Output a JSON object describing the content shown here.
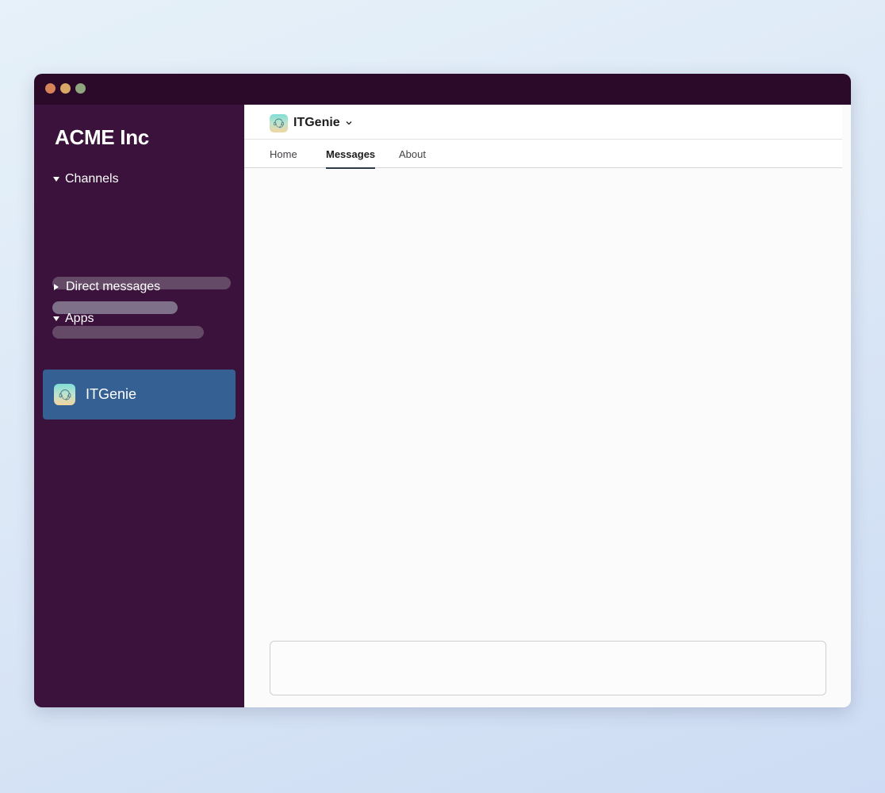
{
  "workspace": {
    "name": "ACME Inc"
  },
  "sidebar": {
    "sections": [
      {
        "label": "Channels",
        "expanded": true
      },
      {
        "label": "Direct messages",
        "expanded": false
      },
      {
        "label": "Apps",
        "expanded": true
      }
    ],
    "channel_placeholders": [
      {
        "color": "#654a68"
      },
      {
        "color": "#7e7088"
      },
      {
        "color": "#654a68"
      }
    ],
    "apps": [
      {
        "label": "ITGenie",
        "icon": "itgenie-app-icon",
        "selected": true
      }
    ]
  },
  "channel": {
    "title": "ITGenie",
    "icon": "itgenie-app-icon",
    "tabs": [
      {
        "label": "Home",
        "active": false
      },
      {
        "label": "Messages",
        "active": true
      },
      {
        "label": "About",
        "active": false
      }
    ]
  },
  "composer": {
    "value": "",
    "placeholder": ""
  },
  "colors": {
    "titlebar": "#2a0a28",
    "sidebar": "#3a123c",
    "selected_item": "#346093",
    "window_dot_red": "#d6835a",
    "window_dot_yellow": "#d9a866",
    "window_dot_green": "#8fa57e"
  }
}
